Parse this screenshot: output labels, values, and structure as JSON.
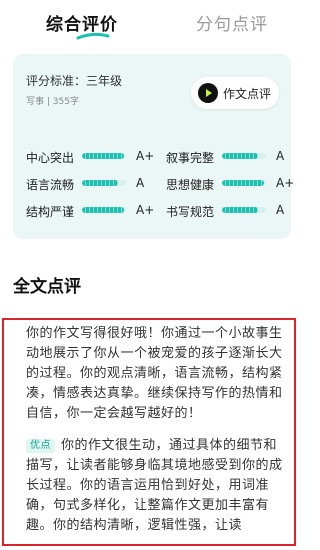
{
  "tabs": [
    {
      "label": "综合评价",
      "active": true
    },
    {
      "label": "分句点评",
      "active": false
    }
  ],
  "summary": {
    "standard": "评分标准：三年级",
    "meta": "写事 | 355字",
    "review_button": "作文点评",
    "metrics": [
      {
        "name": "中心突出",
        "grade": "A+",
        "level": 0.95
      },
      {
        "name": "叙事完整",
        "grade": "A",
        "level": 0.82
      },
      {
        "name": "语言流畅",
        "grade": "A",
        "level": 0.82
      },
      {
        "name": "思想健康",
        "grade": "A+",
        "level": 0.95
      },
      {
        "name": "结构严谨",
        "grade": "A+",
        "level": 0.95
      },
      {
        "name": "书写规范",
        "grade": "A",
        "level": 0.82
      }
    ]
  },
  "full_review": {
    "title": "全文点评",
    "paragraph1": "你的作文写得很好哦！你通过一个小故事生动地展示了你从一个被宠爱的孩子逐渐长大的过程。你的观点清晰，语言流畅，结构紧凑，情感表达真挚。继续保持写作的热情和自信，你一定会越写越好的！",
    "badge": "优点",
    "paragraph2": "你的作文很生动，通过具体的细节和描写，让读者能够身临其境地感受到你的成长过程。你的语言运用恰到好处，用词准确，句式多样化，让整篇作文更加丰富有趣。你的结构清晰，逻辑性强，让读"
  },
  "colors": {
    "accent": "#1dbfb0",
    "card_bg": "#eaf7f6",
    "highlight_border": "#d8252b"
  }
}
